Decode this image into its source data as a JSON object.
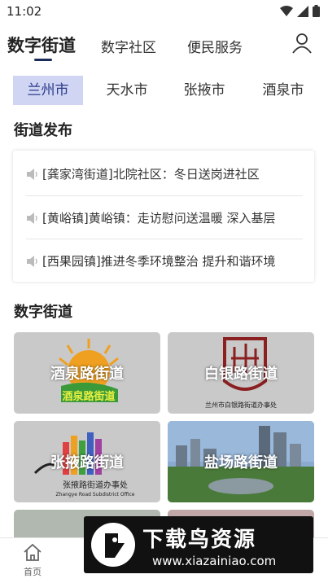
{
  "status_bar": {
    "time": "11:02"
  },
  "top_nav": {
    "tabs": [
      {
        "label": "数字街道"
      },
      {
        "label": "数字社区"
      },
      {
        "label": "便民服务"
      }
    ]
  },
  "city_tabs": [
    {
      "label": "兰州市"
    },
    {
      "label": "天水市"
    },
    {
      "label": "张掖市"
    },
    {
      "label": "酒泉市"
    }
  ],
  "news_section": {
    "title": "街道发布",
    "items": [
      {
        "text": "[龚家湾街道]北院社区：冬日送岗进社区"
      },
      {
        "text": "[黄峪镇]黄峪镇：走访慰问送温暖 深入基层"
      },
      {
        "text": "[西果园镇]推进冬季环境整治 提升和谐环境"
      }
    ]
  },
  "digital_section": {
    "title": "数字街道",
    "tiles": [
      {
        "label": "酒泉路街道",
        "logo_text": "酒泉路街道"
      },
      {
        "label": "白银路街道",
        "caption": "兰州市白银路街道办事处"
      },
      {
        "label": "张掖路街道",
        "logo_text": "张掖路街道办事处",
        "logo_sub": "Zhangye Road Subdistrict Office"
      },
      {
        "label": "盐场路街道"
      }
    ]
  },
  "bottom_nav": {
    "home_label": "首页"
  },
  "watermark": {
    "title": "下载鸟资源",
    "url": "www.xiazainiao.com"
  },
  "colors": {
    "accent": "#2a3a8a",
    "active_tab_bg": "#cfd5f2"
  }
}
